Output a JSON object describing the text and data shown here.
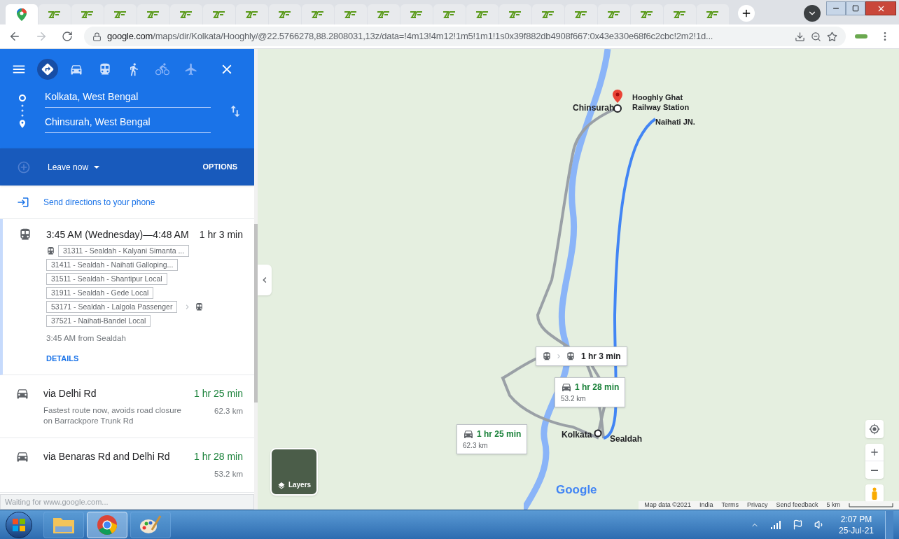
{
  "browser": {
    "tabs": [
      {
        "kind": "maps",
        "selected": true
      },
      {
        "kind": "site",
        "selected": false
      },
      {
        "kind": "site",
        "selected": false
      },
      {
        "kind": "site",
        "selected": false
      },
      {
        "kind": "site",
        "selected": false
      },
      {
        "kind": "site",
        "selected": false
      },
      {
        "kind": "site",
        "selected": false
      },
      {
        "kind": "site",
        "selected": false
      },
      {
        "kind": "site",
        "selected": false
      },
      {
        "kind": "site",
        "selected": false
      },
      {
        "kind": "site",
        "selected": false
      },
      {
        "kind": "site",
        "selected": false
      },
      {
        "kind": "site",
        "selected": false
      },
      {
        "kind": "site",
        "selected": false
      },
      {
        "kind": "site",
        "selected": false
      },
      {
        "kind": "site",
        "selected": false
      },
      {
        "kind": "site",
        "selected": false
      },
      {
        "kind": "site",
        "selected": false
      },
      {
        "kind": "site",
        "selected": false
      },
      {
        "kind": "site",
        "selected": false
      },
      {
        "kind": "site",
        "selected": false
      },
      {
        "kind": "site",
        "selected": false
      }
    ],
    "url_host": "google.com",
    "url_path": "/maps/dir/Kolkata/Hooghly/@22.5766278,88.2808031,13z/data=!4m13!4m12!1m5!1m1!1s0x39f882db4908f667:0x43e330e68f6c2cbc!2m2!1d...",
    "bookmarked": false
  },
  "directions": {
    "modes": [
      {
        "kind": "best",
        "selected": true,
        "disabled": false
      },
      {
        "kind": "car",
        "selected": false,
        "disabled": false
      },
      {
        "kind": "transit",
        "selected": false,
        "disabled": false
      },
      {
        "kind": "walk",
        "selected": false,
        "disabled": false
      },
      {
        "kind": "bike",
        "selected": false,
        "disabled": true
      },
      {
        "kind": "flight",
        "selected": false,
        "disabled": true
      }
    ],
    "origin": "Kolkata, West Bengal",
    "destination": "Chinsurah, West Bengal",
    "leave": "Leave now",
    "options": "OPTIONS",
    "send": "Send directions to your phone",
    "routes": [
      {
        "kind": "transit",
        "selected": true,
        "title": "3:45 AM (Wednesday)—4:48 AM",
        "duration": "1 hr 3 min",
        "trains": [
          {
            "label": "31311 - Sealdah - Kalyani Simanta ...",
            "then_transfer": false
          },
          {
            "label": "31411 - Sealdah - Naihati Galloping...",
            "then_transfer": false
          },
          {
            "label": "31511 - Sealdah - Shantipur Local",
            "then_transfer": false
          },
          {
            "label": "31911 - Sealdah - Gede Local",
            "then_transfer": false
          },
          {
            "label": "53171 - Sealdah - Lalgola Passenger",
            "then_transfer": true
          },
          {
            "label": "37521 - Naihati-Bandel Local",
            "then_transfer": false
          }
        ],
        "note": "3:45 AM from Sealdah",
        "details": "DETAILS"
      },
      {
        "kind": "drive",
        "selected": false,
        "title": "via Delhi Rd",
        "duration": "1 hr 25 min",
        "note": "Fastest route now, avoids road closure on Barrackpore Trunk Rd",
        "distance": "62.3 km"
      },
      {
        "kind": "drive",
        "selected": false,
        "title": "via Benaras Rd and Delhi Rd",
        "duration": "1 hr 28 min",
        "distance": "53.2 km"
      }
    ],
    "status": "Waiting for www.google.com..."
  },
  "map": {
    "places": [
      {
        "kind": "destination",
        "name": "Chinsurah"
      },
      {
        "kind": "station",
        "name": "Hooghly Ghat Railway Station"
      },
      {
        "kind": "station",
        "name": "Naihati JN."
      },
      {
        "kind": "origin",
        "name": "Kolkata"
      },
      {
        "kind": "station",
        "name": "Sealdah"
      }
    ],
    "callouts": [
      {
        "kind": "transit",
        "duration": "1 hr 3 min"
      },
      {
        "kind": "drive",
        "duration": "1 hr 28 min",
        "distance": "53.2 km"
      },
      {
        "kind": "drive",
        "duration": "1 hr 25 min",
        "distance": "62.3 km"
      }
    ],
    "layers": "Layers",
    "logo": "Google",
    "footer": [
      "Map data ©2021",
      "India",
      "Terms",
      "Privacy",
      "Send feedback"
    ],
    "scale": "5 km"
  },
  "taskbar": {
    "apps": [
      {
        "kind": "folder",
        "selected": false
      },
      {
        "kind": "chrome",
        "selected": true
      },
      {
        "kind": "paint",
        "selected": false
      }
    ],
    "time": "2:07 PM",
    "date": "25-Jul-21"
  }
}
